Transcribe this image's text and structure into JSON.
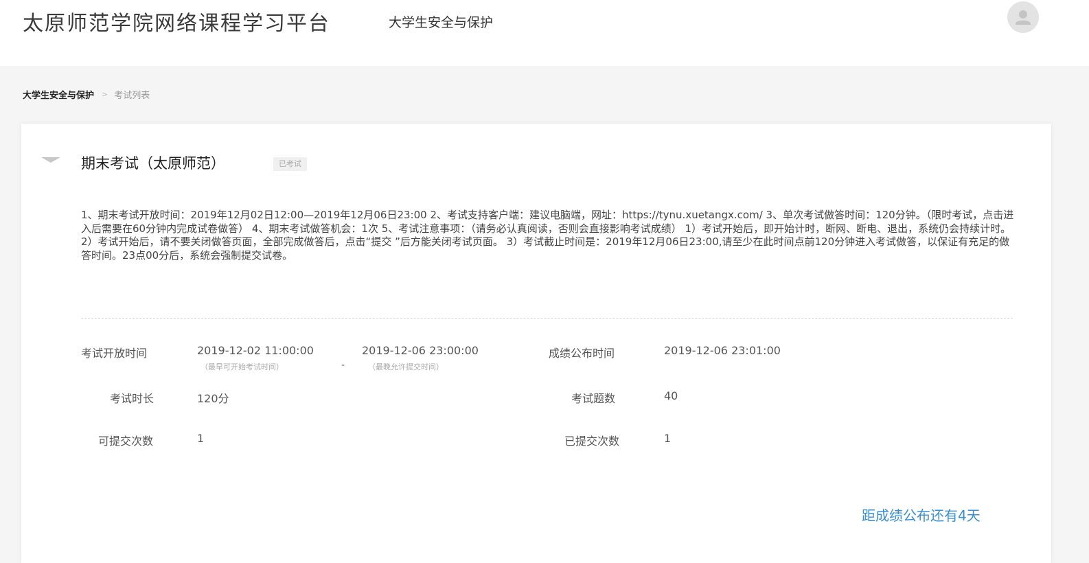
{
  "header": {
    "site_title": "太原师范学院网络课程学习平台",
    "course_name": "大学生安全与保护",
    "avatar_icon": "user-avatar-icon"
  },
  "breadcrumb": {
    "course": "大学生安全与保护",
    "separator": ">",
    "current": "考试列表"
  },
  "exam": {
    "title": "期末考试（太原师范）",
    "status": "已考试",
    "description": "1、期末考试开放时间：2019年12月02日12:00—2019年12月06日23:00 2、考试支持客户端：建议电脑端，网址：https://tynu.xuetangx.com/ 3、单次考试做答时间：120分钟。（限时考试，点击进入后需要在60分钟内完成试卷做答） 4、期末考试做答机会：1次 5、考试注意事项：（请务必认真阅读，否则会直接影响考试成绩） 1）考试开始后，即开始计时，断网、断电、退出，系统仍会持续计时。 2）考试开始后，请不要关闭做答页面，全部完成做答后，点击“提交 ”后方能关闭考试页面。 3）考试截止时间是：2019年12月06日23:00,请至少在此时间点前120分钟进入考试做答，以保证有充足的做答时间。23点00分后，系统会强制提交试卷。",
    "details": {
      "open_time_label": "考试开放时间",
      "open_start": "2019-12-02 11:00:00",
      "open_start_hint": "（最早可开始考试时间）",
      "range_separator": "-",
      "open_end": "2019-12-06 23:00:00",
      "open_end_hint": "（最晚允许提交时间）",
      "result_time_label": "成绩公布时间",
      "result_time": "2019-12-06 23:01:00",
      "duration_label": "考试时长",
      "duration": "120分",
      "question_count_label": "考试题数",
      "question_count": "40",
      "submit_allowed_label": "可提交次数",
      "submit_allowed": "1",
      "submitted_label": "已提交次数",
      "submitted": "1"
    },
    "countdown": "距成绩公布还有4天"
  },
  "colors": {
    "accent": "#3a8fd0",
    "background": "#f5f5f5",
    "card": "#ffffff"
  }
}
